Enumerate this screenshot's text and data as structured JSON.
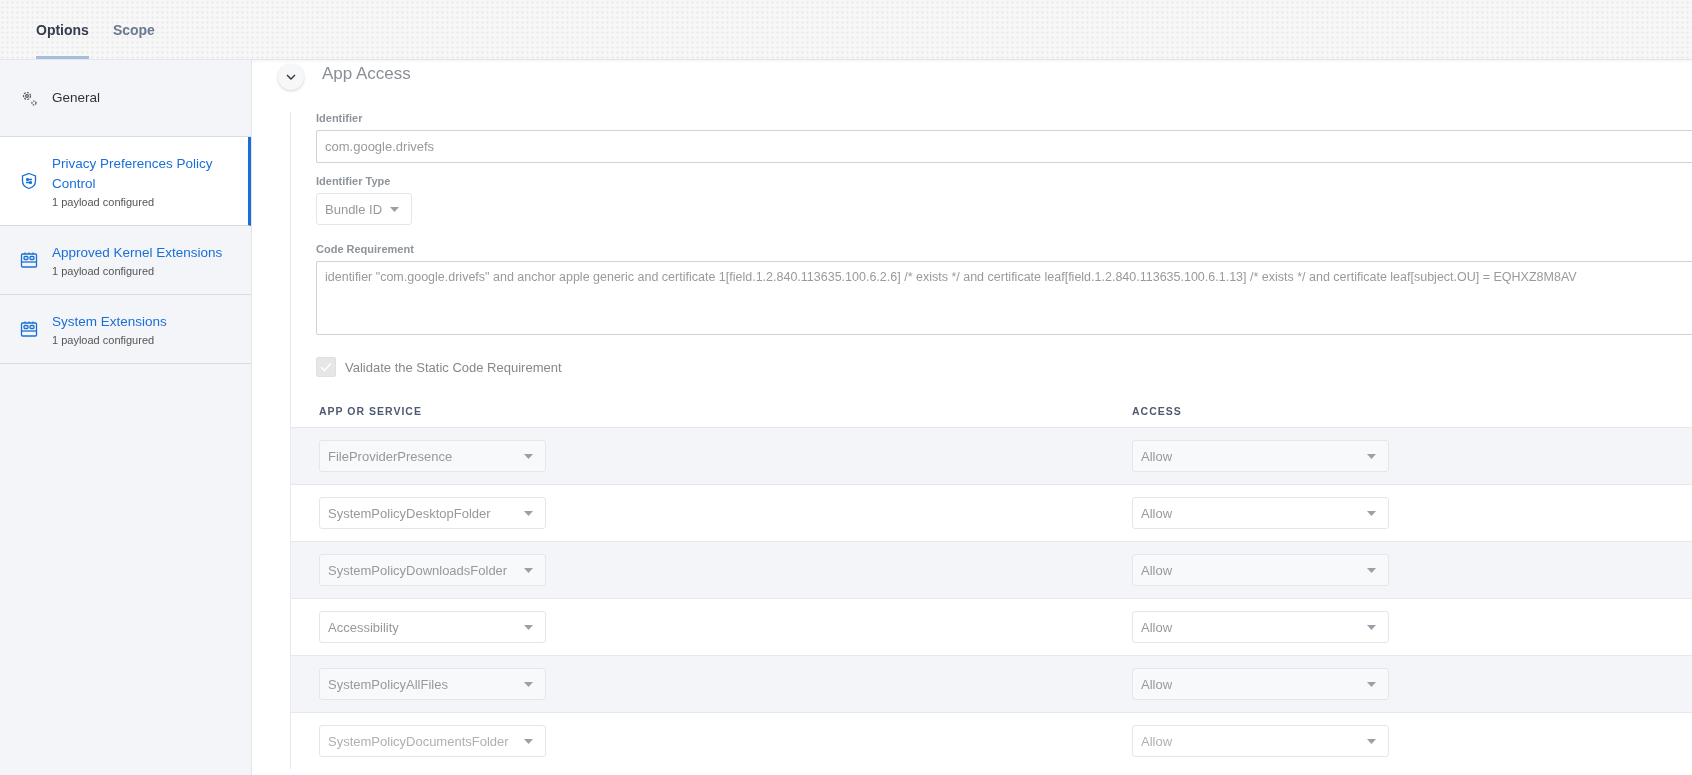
{
  "tabs": [
    {
      "label": "Options",
      "selected": true
    },
    {
      "label": "Scope",
      "selected": false
    }
  ],
  "sidebar": {
    "items": [
      {
        "kind": "gear",
        "title": "General",
        "selected": false
      },
      {
        "kind": "shield",
        "title": "Privacy Preferences Policy Control",
        "subtitle": "1 payload configured",
        "selected": true
      },
      {
        "kind": "kernel",
        "title": "Approved Kernel Extensions",
        "subtitle": "1 payload configured",
        "selected": false
      },
      {
        "kind": "kernel",
        "title": "System Extensions",
        "subtitle": "1 payload configured",
        "selected": false
      }
    ]
  },
  "section": {
    "title": "App Access",
    "expanded": true,
    "identifier": {
      "label": "Identifier",
      "value": "com.google.drivefs"
    },
    "identifier_type": {
      "label": "Identifier Type",
      "value": "Bundle ID"
    },
    "code_requirement": {
      "label": "Code Requirement",
      "value": "identifier \"com.google.drivefs\" and anchor apple generic and certificate 1[field.1.2.840.113635.100.6.2.6] /* exists */ and certificate leaf[field.1.2.840.113635.100.6.1.13] /* exists */ and certificate leaf[subject.OU] = EQHXZ8M8AV"
    },
    "validate": {
      "label": "Validate the Static Code Requirement",
      "checked": true,
      "disabled": true
    },
    "table": {
      "columns": [
        "APP OR SERVICE",
        "ACCESS"
      ],
      "rows": [
        {
          "service": "FileProviderPresence",
          "access": "Allow"
        },
        {
          "service": "SystemPolicyDesktopFolder",
          "access": "Allow"
        },
        {
          "service": "SystemPolicyDownloadsFolder",
          "access": "Allow"
        },
        {
          "service": "Accessibility",
          "access": "Allow"
        },
        {
          "service": "SystemPolicyAllFiles",
          "access": "Allow"
        },
        {
          "service": "SystemPolicyDocumentsFolder",
          "access": "Allow"
        }
      ]
    }
  }
}
